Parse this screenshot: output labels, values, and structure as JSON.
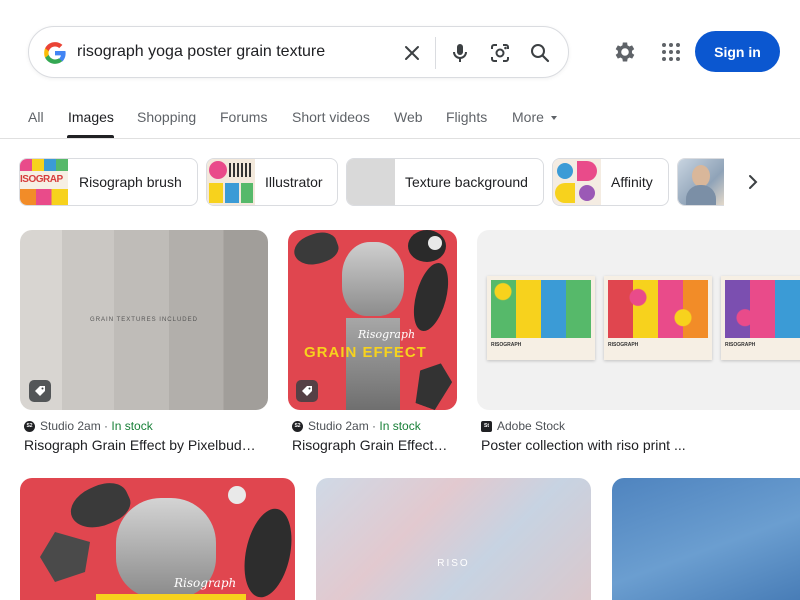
{
  "search": {
    "query": "risograph yoga poster grain texture"
  },
  "header": {
    "signin_label": "Sign in"
  },
  "tabs": [
    {
      "label": "All"
    },
    {
      "label": "Images"
    },
    {
      "label": "Shopping"
    },
    {
      "label": "Forums"
    },
    {
      "label": "Short videos"
    },
    {
      "label": "Web"
    },
    {
      "label": "Flights"
    },
    {
      "label": "More"
    }
  ],
  "chips": [
    {
      "label": "Risograph brush",
      "thumb_text": "ISOGRAP"
    },
    {
      "label": "Illustrator"
    },
    {
      "label": "Texture background"
    },
    {
      "label": "Affinity"
    }
  ],
  "results": [
    {
      "source": "Studio 2am",
      "stock": "In stock",
      "title": "Risograph Grain Effect by Pixelbud…",
      "image_text": "GRAIN TEXTURES INCLUDED"
    },
    {
      "source": "Studio 2am",
      "stock": "In stock",
      "title": "Risograph Grain Effect…",
      "image_script": "Risograph",
      "image_headline": "GRAIN EFFECT"
    },
    {
      "source": "Adobe Stock",
      "title": "Poster collection with riso print ...",
      "poster_label": "RISOGRAPH"
    },
    {
      "image_script": "Risograph"
    },
    {
      "image_text": "RISO"
    },
    {}
  ],
  "colors": {
    "accent": "#0b57d0",
    "in_stock": "#188038",
    "riso_red": "#e0464f",
    "riso_yellow": "#f7d21d"
  }
}
